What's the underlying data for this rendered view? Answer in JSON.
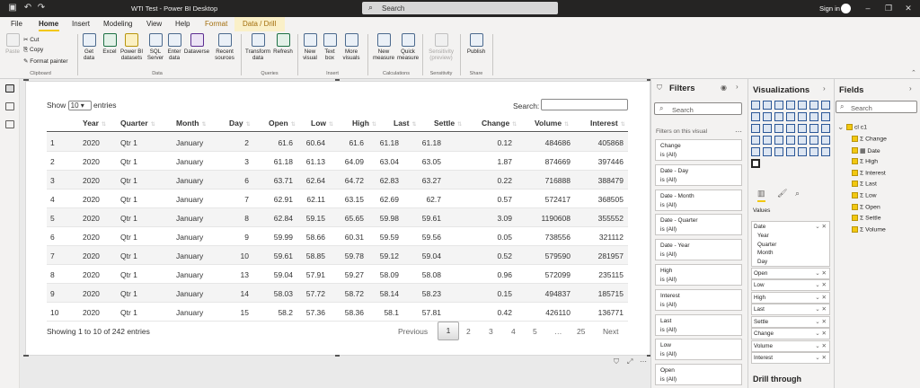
{
  "titlebar": {
    "title": "WTI Test - Power BI Desktop",
    "search_placeholder": "Search",
    "signin": "Sign in"
  },
  "tabs": [
    "File",
    "Home",
    "Insert",
    "Modeling",
    "View",
    "Help",
    "Format",
    "Data / Drill"
  ],
  "ribbon": {
    "clipboard": {
      "paste": "Paste",
      "cut": "Cut",
      "copy": "Copy",
      "format_painter": "Format painter",
      "group": "Clipboard"
    },
    "data": {
      "get_data": "Get data",
      "excel": "Excel",
      "power_bi_datasets": "Power BI datasets",
      "sql_server": "SQL Server",
      "enter_data": "Enter data",
      "dataverse": "Dataverse",
      "recent_sources": "Recent sources",
      "group": "Data"
    },
    "queries": {
      "transform_data": "Transform data",
      "refresh": "Refresh",
      "group": "Queries"
    },
    "insert": {
      "new_visual": "New visual",
      "text_box": "Text box",
      "more_visuals": "More visuals",
      "group": "Insert"
    },
    "calculations": {
      "new_measure": "New measure",
      "quick_measure": "Quick measure",
      "group": "Calculations"
    },
    "sensitivity": {
      "label": "Sensitivity (preview)",
      "group": "Sensitivity"
    },
    "share": {
      "publish": "Publish",
      "group": "Share"
    }
  },
  "table": {
    "show_label": "Show",
    "show_value": "10",
    "entries_label": "entries",
    "search_label": "Search:",
    "columns": [
      "Year",
      "Quarter",
      "Month",
      "Day",
      "Open",
      "Low",
      "High",
      "Last",
      "Settle",
      "Change",
      "Volume",
      "Interest"
    ],
    "rows": [
      [
        "1",
        "2020",
        "Qtr 1",
        "January",
        "2",
        "61.6",
        "60.64",
        "61.6",
        "61.18",
        "61.18",
        "0.12",
        "484686",
        "405868"
      ],
      [
        "2",
        "2020",
        "Qtr 1",
        "January",
        "3",
        "61.18",
        "61.13",
        "64.09",
        "63.04",
        "63.05",
        "1.87",
        "874669",
        "397446"
      ],
      [
        "3",
        "2020",
        "Qtr 1",
        "January",
        "6",
        "63.71",
        "62.64",
        "64.72",
        "62.83",
        "63.27",
        "0.22",
        "716888",
        "388479"
      ],
      [
        "4",
        "2020",
        "Qtr 1",
        "January",
        "7",
        "62.91",
        "62.11",
        "63.15",
        "62.69",
        "62.7",
        "0.57",
        "572417",
        "368505"
      ],
      [
        "5",
        "2020",
        "Qtr 1",
        "January",
        "8",
        "62.84",
        "59.15",
        "65.65",
        "59.98",
        "59.61",
        "3.09",
        "1190608",
        "355552"
      ],
      [
        "6",
        "2020",
        "Qtr 1",
        "January",
        "9",
        "59.99",
        "58.66",
        "60.31",
        "59.59",
        "59.56",
        "0.05",
        "738556",
        "321112"
      ],
      [
        "7",
        "2020",
        "Qtr 1",
        "January",
        "10",
        "59.61",
        "58.85",
        "59.78",
        "59.12",
        "59.04",
        "0.52",
        "579590",
        "281957"
      ],
      [
        "8",
        "2020",
        "Qtr 1",
        "January",
        "13",
        "59.04",
        "57.91",
        "59.27",
        "58.09",
        "58.08",
        "0.96",
        "572099",
        "235115"
      ],
      [
        "9",
        "2020",
        "Qtr 1",
        "January",
        "14",
        "58.03",
        "57.72",
        "58.72",
        "58.14",
        "58.23",
        "0.15",
        "494837",
        "185715"
      ],
      [
        "10",
        "2020",
        "Qtr 1",
        "January",
        "15",
        "58.2",
        "57.36",
        "58.36",
        "58.1",
        "57.81",
        "0.42",
        "426110",
        "136771"
      ]
    ],
    "info": "Showing 1 to 10 of 242 entries",
    "pagination": {
      "previous": "Previous",
      "pages": [
        "1",
        "2",
        "3",
        "4",
        "5",
        "…",
        "25"
      ],
      "current": "1",
      "next": "Next"
    }
  },
  "filters": {
    "title": "Filters",
    "search_placeholder": "Search",
    "section": "Filters on this visual",
    "cards": [
      {
        "name": "Change",
        "value": "is (All)"
      },
      {
        "name": "Date - Day",
        "value": "is (All)"
      },
      {
        "name": "Date - Month",
        "value": "is (All)"
      },
      {
        "name": "Date - Quarter",
        "value": "is (All)"
      },
      {
        "name": "Date - Year",
        "value": "is (All)"
      },
      {
        "name": "High",
        "value": "is (All)"
      },
      {
        "name": "Interest",
        "value": "is (All)"
      },
      {
        "name": "Last",
        "value": "is (All)"
      },
      {
        "name": "Low",
        "value": "is (All)"
      },
      {
        "name": "Open",
        "value": "is (All)"
      }
    ]
  },
  "visualizations": {
    "title": "Visualizations",
    "values_label": "Values",
    "wells": [
      {
        "name": "Date",
        "children": [
          "Year",
          "Quarter",
          "Month",
          "Day"
        ]
      },
      {
        "name": "Open"
      },
      {
        "name": "Low"
      },
      {
        "name": "High"
      },
      {
        "name": "Last"
      },
      {
        "name": "Settle"
      },
      {
        "name": "Change"
      },
      {
        "name": "Volume"
      },
      {
        "name": "Interest"
      }
    ],
    "drill_through": "Drill through"
  },
  "fields": {
    "title": "Fields",
    "search_placeholder": "Search",
    "table_name": "cl c1",
    "items": [
      "Change",
      "Date",
      "High",
      "Interest",
      "Last",
      "Low",
      "Open",
      "Settle",
      "Volume"
    ]
  },
  "colors": {
    "accent": "#f2c811",
    "titlebar": "#252423",
    "panel": "#f3f2f1"
  }
}
